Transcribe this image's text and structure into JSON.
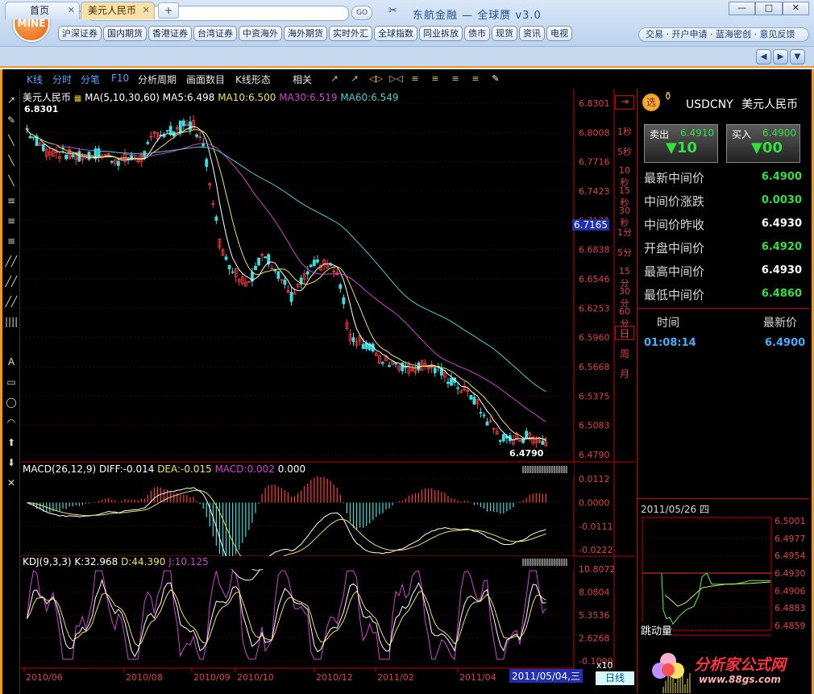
{
  "app": {
    "logo": "MINE",
    "nav_arrows": "◀ ▶",
    "go": "GO",
    "name": "东航金融 — 全球赝 v3.0"
  },
  "window_buttons": [
    "—",
    "□",
    "✕"
  ],
  "market_tabs": [
    "沪深证券",
    "国内期货",
    "香港证券",
    "台湾证券",
    "中资海外",
    "海外期货",
    "实时外汇",
    "全球指数",
    "同业拆放",
    "债市",
    "现货",
    "资讯",
    "电视"
  ],
  "services": "交易 · 开户申请 · 蓝海密创 · 意见反馈",
  "tabs": [
    {
      "label": "首页",
      "close": "✕"
    },
    {
      "label": "美元人民币",
      "close": "✕"
    }
  ],
  "newtab": "+",
  "tab_nav": [
    "◀",
    "▶",
    "▼"
  ],
  "toolbar": {
    "items": [
      "K线",
      "分时",
      "分笔",
      "F10",
      "分析周期",
      "画面数目",
      "K线形态",
      "相关"
    ],
    "icons": [
      "↗",
      "↗",
      "◁▷",
      "▷◁",
      "≡",
      "≡",
      "≡",
      "≡",
      "✎"
    ]
  },
  "left_tools": [
    "↗",
    "✎",
    "╲",
    "╲",
    "╲",
    "≡",
    "≡",
    "≡",
    "╱╱",
    "╱╱",
    "╱╱",
    "||||",
    "A",
    "▭",
    "◯",
    "◠",
    "⬆",
    "⬇",
    "✕"
  ],
  "kline": {
    "title": "美元人民币",
    "ma_label": "MA(5,10,30,60)",
    "ma5": "MA5:6.498",
    "ma10": "MA10:6.500",
    "ma30": "MA30:6.519",
    "ma60": "MA60:6.549",
    "high_label": "6.8301",
    "low_label": "6.4790",
    "cursor_price": "6.7165",
    "yticks": [
      "6.8301",
      "6.8008",
      "6.7716",
      "6.7423",
      "6.7131",
      "6.6838",
      "6.6546",
      "6.6253",
      "6.5960",
      "6.5668",
      "6.5375",
      "6.5083",
      "6.4790"
    ]
  },
  "macd": {
    "label": "MACD(26,12,9)",
    "diff": "DIFF:-0.014",
    "dea": "DEA:-0.015",
    "macd": "MACD:0.002",
    "extra": "0.000",
    "yticks": [
      "0.0112",
      "0.0000",
      "-0.0111",
      "-0.0222"
    ]
  },
  "kdj": {
    "label": "KDJ(9,3,3)",
    "k": "K:32.968",
    "d": "D:44.390",
    "j": "J:10.125",
    "yticks": [
      "10.8072",
      "8.0804",
      "5.3536",
      "2.6268",
      "-0.1000"
    ]
  },
  "xaxis": {
    "ticks": [
      "2010/06",
      "2010/08",
      "2010/09",
      "2010/10",
      "2010/12",
      "2011/02",
      "2011/04"
    ],
    "cursor_date": "2011/05/04,三",
    "zoom": "x10",
    "period": "日线"
  },
  "periods": [
    "1秒",
    "5秒",
    "10秒",
    "15秒",
    "30秒",
    "1分",
    "5分",
    "15分",
    "30分",
    "60分",
    "日",
    "周",
    "月"
  ],
  "quote": {
    "badge": "选",
    "symbol": "USDCNY",
    "name": "美元人民币",
    "sell_label": "卖出",
    "sell_price": "6.4910",
    "sell_vol": "▼10",
    "buy_label": "买入",
    "buy_price": "6.4900",
    "buy_vol": "▼00",
    "rows": [
      {
        "label": "最新中间价",
        "value": "6.4900"
      },
      {
        "label": "中间价涨跌",
        "value": "0.0030"
      },
      {
        "label": "中间价昨收",
        "value": "6.4930"
      },
      {
        "label": "开盘中间价",
        "value": "6.4920"
      },
      {
        "label": "最高中间价",
        "value": "6.4930"
      },
      {
        "label": "最低中间价",
        "value": "6.4860"
      }
    ],
    "ticks_header": {
      "time": "时间",
      "price": "最新价"
    },
    "ticks": [
      {
        "time": "01:08:14",
        "price": "6.4900"
      }
    ]
  },
  "mini": {
    "date": "2011/05/26 四",
    "yticks": [
      "6.5001",
      "6.4977",
      "6.4954",
      "6.4930",
      "6.4906",
      "6.4883",
      "6.4859"
    ],
    "volume_label": "跳动量"
  },
  "watermark": {
    "text": "分析家公式网",
    "url": "www.88gs.com"
  },
  "colors": {
    "up": "#ff3b3b",
    "down": "#38e0e0",
    "ma5": "#ffffff",
    "ma10": "#f2e34a",
    "ma30": "#d040d0",
    "ma60": "#40d0d0",
    "accent": "#f39a1e"
  }
}
